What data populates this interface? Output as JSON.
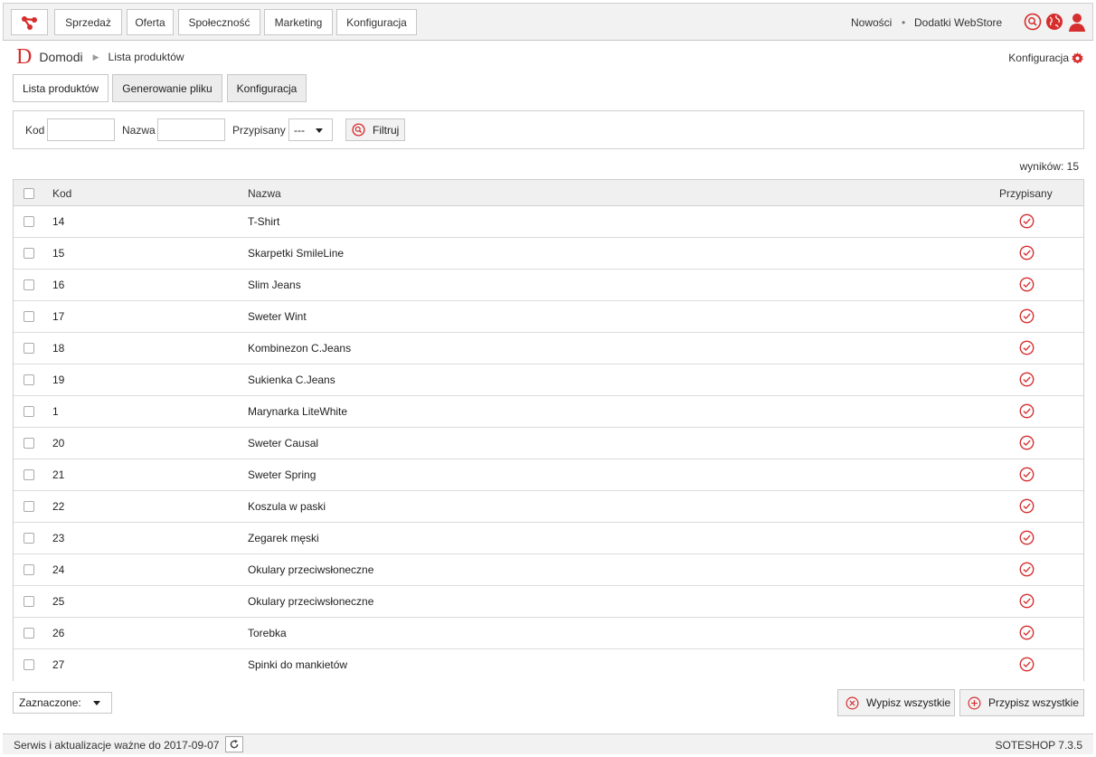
{
  "nav": {
    "items": [
      "Sprzedaż",
      "Oferta",
      "Społeczność",
      "Marketing",
      "Konfiguracja"
    ],
    "news": "Nowości",
    "separator": "•",
    "addons": "Dodatki WebStore"
  },
  "breadcrumb": {
    "brand_letter": "D",
    "app": "Domodi",
    "page": "Lista produktów"
  },
  "config_link": "Konfiguracja",
  "tabs": [
    "Lista produktów",
    "Generowanie pliku",
    "Konfiguracja"
  ],
  "filter": {
    "kod_label": "Kod",
    "kod_value": "",
    "nazwa_label": "Nazwa",
    "nazwa_value": "",
    "przypisany_label": "Przypisany",
    "przypisany_value": "---",
    "button": "Filtruj"
  },
  "results": "wyników: 15",
  "table": {
    "headers": {
      "kod": "Kod",
      "nazwa": "Nazwa",
      "przypisany": "Przypisany"
    },
    "rows": [
      {
        "kod": "14",
        "nazwa": "T-Shirt"
      },
      {
        "kod": "15",
        "nazwa": "Skarpetki SmileLine"
      },
      {
        "kod": "16",
        "nazwa": "Slim Jeans"
      },
      {
        "kod": "17",
        "nazwa": "Sweter Wint"
      },
      {
        "kod": "18",
        "nazwa": "Kombinezon C.Jeans"
      },
      {
        "kod": "19",
        "nazwa": "Sukienka C.Jeans"
      },
      {
        "kod": "1",
        "nazwa": "Marynarka LiteWhite"
      },
      {
        "kod": "20",
        "nazwa": "Sweter Causal"
      },
      {
        "kod": "21",
        "nazwa": "Sweter Spring"
      },
      {
        "kod": "22",
        "nazwa": "Koszula w paski"
      },
      {
        "kod": "23",
        "nazwa": "Zegarek męski"
      },
      {
        "kod": "24",
        "nazwa": "Okulary przeciwsłoneczne"
      },
      {
        "kod": "25",
        "nazwa": "Okulary przeciwsłoneczne"
      },
      {
        "kod": "26",
        "nazwa": "Torebka"
      },
      {
        "kod": "27",
        "nazwa": "Spinki do mankietów"
      }
    ]
  },
  "bulk": {
    "select_label": "Zaznaczone:"
  },
  "actions": {
    "unassign_all": "Wypisz wszystkie",
    "assign_all": "Przypisz wszystkie"
  },
  "footer": {
    "service": "Serwis i aktualizacje ważne do 2017-09-07",
    "version": "SOTESHOP 7.3.5"
  },
  "colors": {
    "accent": "#d62d2d"
  },
  "icons": [
    "share-logo-icon",
    "search-icon",
    "globe-icon",
    "user-icon",
    "gear-icon",
    "check-circle-icon",
    "cross-circle-icon",
    "plus-circle-icon",
    "refresh-icon",
    "caret-down-icon"
  ]
}
